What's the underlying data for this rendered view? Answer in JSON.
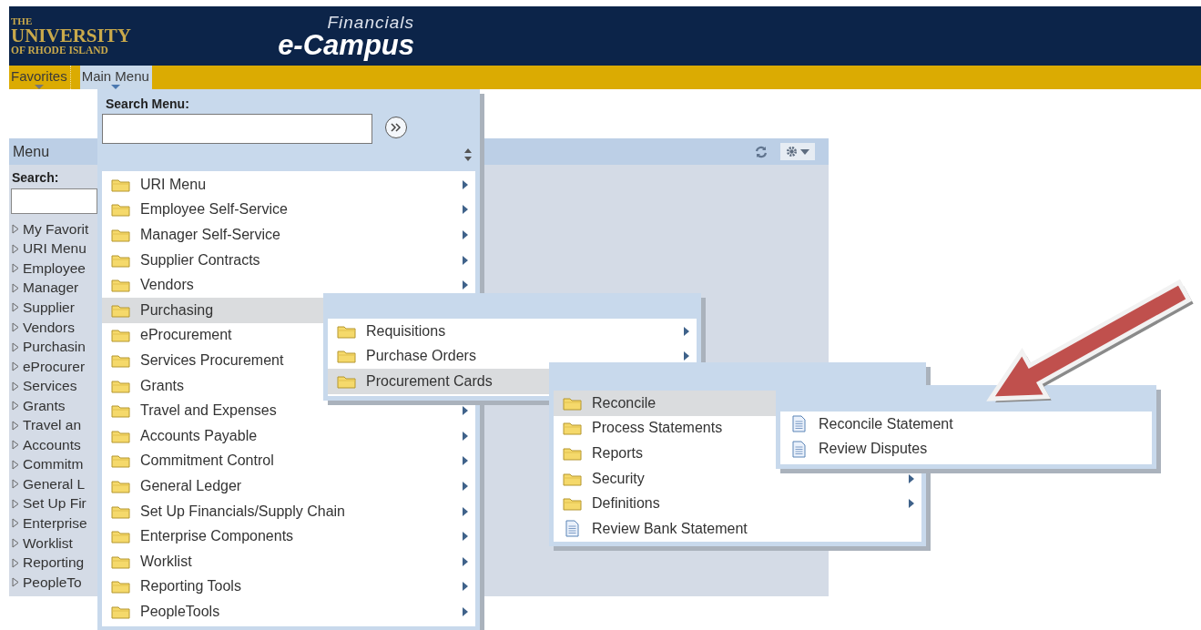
{
  "header": {
    "logo": [
      "THE",
      "UNIVERSITY",
      "OF RHODE ISLAND"
    ],
    "subtitle": "Financials",
    "title": "e-Campus"
  },
  "nav": [
    {
      "label": "Favorites",
      "selected": false
    },
    {
      "label": "Main Menu",
      "selected": true
    }
  ],
  "menu_pagelet": {
    "title": "Menu",
    "search_label": "Search:",
    "items": [
      "My Favorit",
      "URI Menu",
      "Employee",
      "Manager",
      "Supplier",
      "Vendors",
      "Purchasin",
      "eProcurer",
      "Services",
      "Grants",
      "Travel an",
      "Accounts",
      "Commitm",
      "General L",
      "Set Up Fir",
      "Enterprise",
      "Worklist",
      "Reporting",
      "PeopleTo"
    ]
  },
  "main_menu": {
    "search_label": "Search Menu:",
    "items": [
      {
        "label": "URI Menu",
        "kind": "folder",
        "arrow": true,
        "selected": false
      },
      {
        "label": "Employee Self-Service",
        "kind": "folder",
        "arrow": true,
        "selected": false
      },
      {
        "label": "Manager Self-Service",
        "kind": "folder",
        "arrow": true,
        "selected": false
      },
      {
        "label": "Supplier Contracts",
        "kind": "folder",
        "arrow": true,
        "selected": false
      },
      {
        "label": "Vendors",
        "kind": "folder",
        "arrow": true,
        "selected": false
      },
      {
        "label": "Purchasing",
        "kind": "folder",
        "arrow": false,
        "selected": true
      },
      {
        "label": "eProcurement",
        "kind": "folder",
        "arrow": false,
        "selected": false
      },
      {
        "label": "Services Procurement",
        "kind": "folder",
        "arrow": false,
        "selected": false
      },
      {
        "label": "Grants",
        "kind": "folder",
        "arrow": false,
        "selected": false
      },
      {
        "label": "Travel and Expenses",
        "kind": "folder",
        "arrow": true,
        "selected": false
      },
      {
        "label": "Accounts Payable",
        "kind": "folder",
        "arrow": true,
        "selected": false
      },
      {
        "label": "Commitment Control",
        "kind": "folder",
        "arrow": true,
        "selected": false
      },
      {
        "label": "General Ledger",
        "kind": "folder",
        "arrow": true,
        "selected": false
      },
      {
        "label": "Set Up Financials/Supply Chain",
        "kind": "folder",
        "arrow": true,
        "selected": false
      },
      {
        "label": "Enterprise Components",
        "kind": "folder",
        "arrow": true,
        "selected": false
      },
      {
        "label": "Worklist",
        "kind": "folder",
        "arrow": true,
        "selected": false
      },
      {
        "label": "Reporting Tools",
        "kind": "folder",
        "arrow": true,
        "selected": false
      },
      {
        "label": "PeopleTools",
        "kind": "folder",
        "arrow": true,
        "selected": false
      }
    ]
  },
  "submenus": [
    {
      "items": [
        {
          "label": "Requisitions",
          "kind": "folder",
          "arrow": true,
          "selected": false
        },
        {
          "label": "Purchase Orders",
          "kind": "folder",
          "arrow": true,
          "selected": false
        },
        {
          "label": "Procurement Cards",
          "kind": "folder",
          "arrow": false,
          "selected": true
        }
      ]
    },
    {
      "items": [
        {
          "label": "Reconcile",
          "kind": "folder",
          "arrow": false,
          "selected": true
        },
        {
          "label": "Process Statements",
          "kind": "folder",
          "arrow": false,
          "selected": false
        },
        {
          "label": "Reports",
          "kind": "folder",
          "arrow": false,
          "selected": false
        },
        {
          "label": "Security",
          "kind": "folder",
          "arrow": true,
          "selected": false
        },
        {
          "label": "Definitions",
          "kind": "folder",
          "arrow": true,
          "selected": false
        },
        {
          "label": "Review Bank Statement",
          "kind": "page",
          "arrow": false,
          "selected": false
        }
      ]
    },
    {
      "items": [
        {
          "label": "Reconcile Statement",
          "kind": "page",
          "arrow": false,
          "selected": false
        },
        {
          "label": "Review Disputes",
          "kind": "page",
          "arrow": false,
          "selected": false
        }
      ]
    }
  ]
}
